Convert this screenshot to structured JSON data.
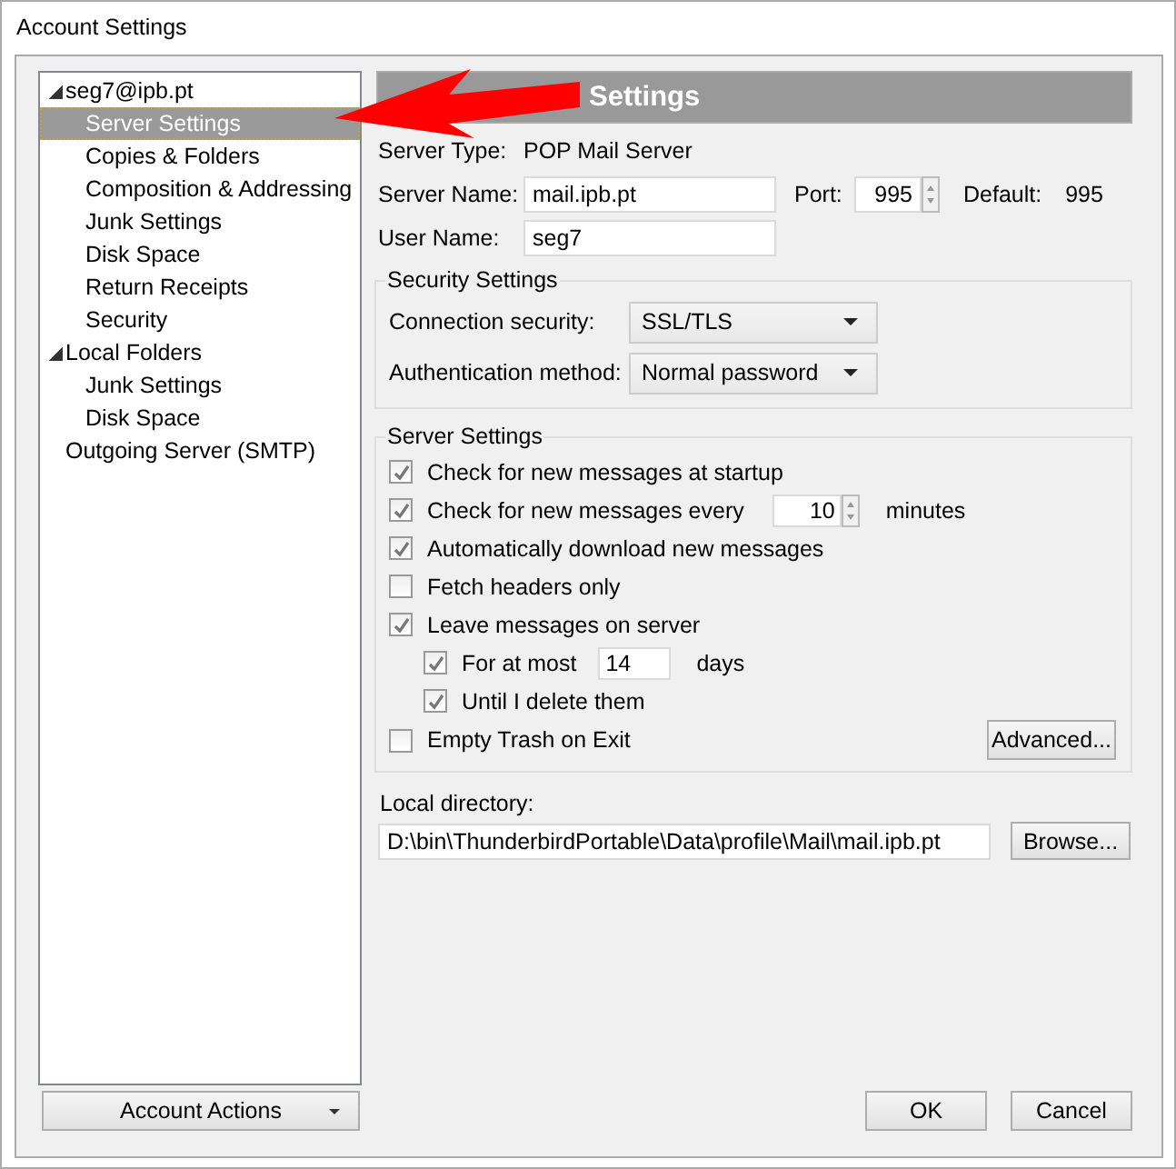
{
  "window": {
    "title": "Account Settings"
  },
  "tree": [
    {
      "label": "seg7@ipb.pt",
      "selected": false,
      "expanded": true,
      "children": [
        {
          "label": "Server Settings",
          "selected": true
        },
        {
          "label": "Copies & Folders",
          "selected": false
        },
        {
          "label": "Composition & Addressing",
          "selected": false
        },
        {
          "label": "Junk Settings",
          "selected": false
        },
        {
          "label": "Disk Space",
          "selected": false
        },
        {
          "label": "Return Receipts",
          "selected": false
        },
        {
          "label": "Security",
          "selected": false
        }
      ]
    },
    {
      "label": "Local Folders",
      "selected": false,
      "expanded": true,
      "children": [
        {
          "label": "Junk Settings",
          "selected": false
        },
        {
          "label": "Disk Space",
          "selected": false
        }
      ]
    },
    {
      "label": "Outgoing Server (SMTP)",
      "selected": false
    }
  ],
  "account_actions": {
    "label": "Account Actions"
  },
  "header": {
    "title": "Settings"
  },
  "server_type": {
    "label": "Server Type:",
    "value": "POP Mail Server"
  },
  "server_name": {
    "label": "Server Name:",
    "value": "mail.ipb.pt"
  },
  "port": {
    "label": "Port:",
    "value": "995",
    "default_label": "Default:",
    "default_value": "995"
  },
  "user_name": {
    "label": "User Name:",
    "value": "seg7"
  },
  "security": {
    "title": "Security Settings",
    "fields": [
      {
        "label": "Connection security:",
        "value": "SSL/TLS"
      },
      {
        "label": "Authentication method:",
        "value": "Normal password"
      }
    ]
  },
  "server_settings": {
    "title": "Server Settings",
    "options": [
      {
        "kind": "plain",
        "label": "Check for new messages at startup",
        "checked": true
      },
      {
        "kind": "spinner",
        "label": "Check for new messages every",
        "value": "10",
        "unit": "minutes",
        "checked": true
      },
      {
        "kind": "plain",
        "label": "Automatically download new messages",
        "checked": true
      },
      {
        "kind": "plain",
        "label": "Fetch headers only",
        "checked": false
      },
      {
        "kind": "plain",
        "label": "Leave messages on server",
        "checked": true,
        "children": [
          {
            "kind": "field",
            "label": "For at most",
            "value": "14",
            "unit": "days",
            "checked": true
          },
          {
            "kind": "plain",
            "label": "Until I delete them",
            "checked": true
          }
        ]
      },
      {
        "kind": "plain",
        "label": "Empty Trash on Exit",
        "checked": false
      }
    ],
    "advanced_button": "Advanced..."
  },
  "local_directory": {
    "label": "Local directory:",
    "value": "D:\\bin\\ThunderbirdPortable\\Data\\profile\\Mail\\mail.ipb.pt",
    "button": "Browse..."
  },
  "buttons": [
    "OK",
    "Cancel"
  ]
}
